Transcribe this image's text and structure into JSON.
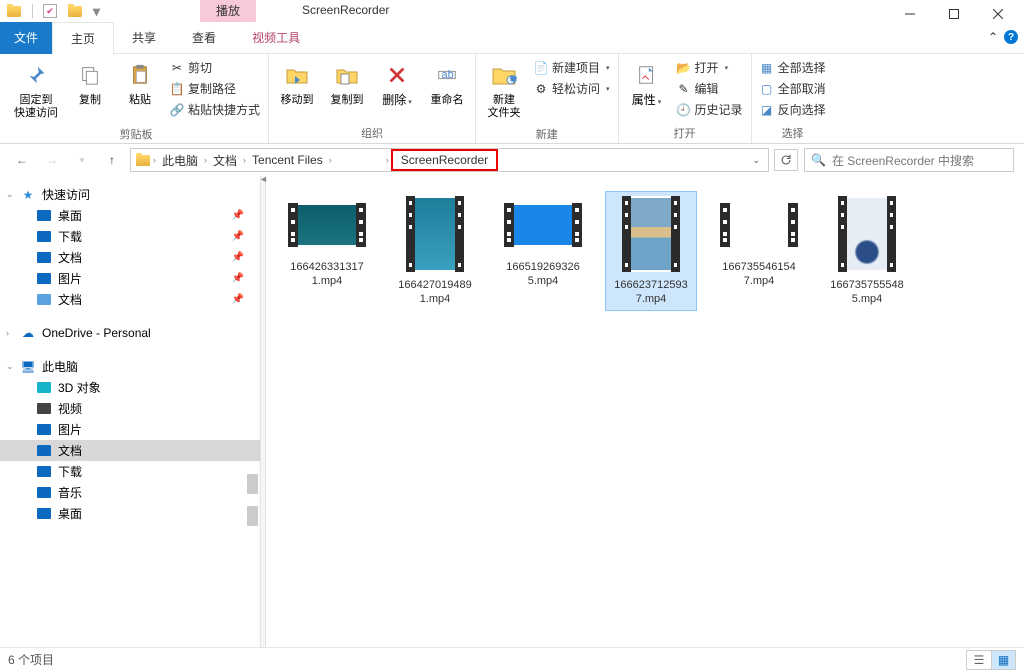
{
  "title": "ScreenRecorder",
  "top_tab_play": "播放",
  "top_tab_video": "视频工具",
  "tabs": {
    "file": "文件",
    "home": "主页",
    "share": "共享",
    "view": "查看"
  },
  "ribbon": {
    "clipboard": {
      "label": "剪贴板",
      "pin": "固定到\n快速访问",
      "copy": "复制",
      "paste": "粘贴",
      "cut": "剪切",
      "copypath": "复制路径",
      "pastelink": "粘贴快捷方式"
    },
    "organize": {
      "label": "组织",
      "moveto": "移动到",
      "copyto": "复制到",
      "delete": "删除",
      "rename": "重命名"
    },
    "new": {
      "label": "新建",
      "newfolder": "新建\n文件夹",
      "newitem": "新建项目",
      "easyaccess": "轻松访问"
    },
    "open": {
      "label": "打开",
      "properties": "属性",
      "open": "打开",
      "edit": "编辑",
      "history": "历史记录"
    },
    "select": {
      "label": "选择",
      "selectall": "全部选择",
      "selectnone": "全部取消",
      "invert": "反向选择"
    }
  },
  "breadcrumbs": [
    "此电脑",
    "文档",
    "Tencent Files",
    "",
    "ScreenRecorder"
  ],
  "search_placeholder": "在 ScreenRecorder 中搜索",
  "sidebar": {
    "quickaccess": "快速访问",
    "qa_items": [
      {
        "label": "桌面",
        "pin": true,
        "icon": "desktop"
      },
      {
        "label": "下载",
        "pin": true,
        "icon": "download"
      },
      {
        "label": "文档",
        "pin": true,
        "icon": "doc"
      },
      {
        "label": "图片",
        "pin": true,
        "icon": "pic"
      },
      {
        "label": "文档",
        "pin": true,
        "icon": "filedoc"
      }
    ],
    "onedrive": "OneDrive - Personal",
    "thispc": "此电脑",
    "pc_items": [
      {
        "label": "3D 对象",
        "icon": "cube"
      },
      {
        "label": "视频",
        "icon": "video"
      },
      {
        "label": "图片",
        "icon": "pic"
      },
      {
        "label": "文档",
        "icon": "doc",
        "selected": true
      },
      {
        "label": "下载",
        "icon": "download"
      },
      {
        "label": "音乐",
        "icon": "music"
      },
      {
        "label": "桌面",
        "icon": "desktop"
      }
    ]
  },
  "files": [
    {
      "name": "1664263313171.mp4",
      "shape": "wide",
      "bg": "linear-gradient(#0d5d6c,#1a747f)"
    },
    {
      "name": "1664270194891.mp4",
      "shape": "tall",
      "bg": "linear-gradient(#1e7e9a,#3aa0bf)"
    },
    {
      "name": "1665192693265.mp4",
      "shape": "wide",
      "bg": "#1a86e8"
    },
    {
      "name": "1666237125937.mp4",
      "shape": "tall",
      "bg": "linear-gradient(#7fa9c9 40%,#d9c08a 40%,#d9c08a 55%,#6fa3c7 55%)",
      "selected": true
    },
    {
      "name": "1667355461547.mp4",
      "shape": "wide",
      "bg": "#ffffff"
    },
    {
      "name": "1667357555485.mp4",
      "shape": "tall",
      "bg": "radial-gradient(circle at 50% 75%, #2b4e88 18%, #e6edf5 22%)"
    }
  ],
  "status": "6 个项目"
}
